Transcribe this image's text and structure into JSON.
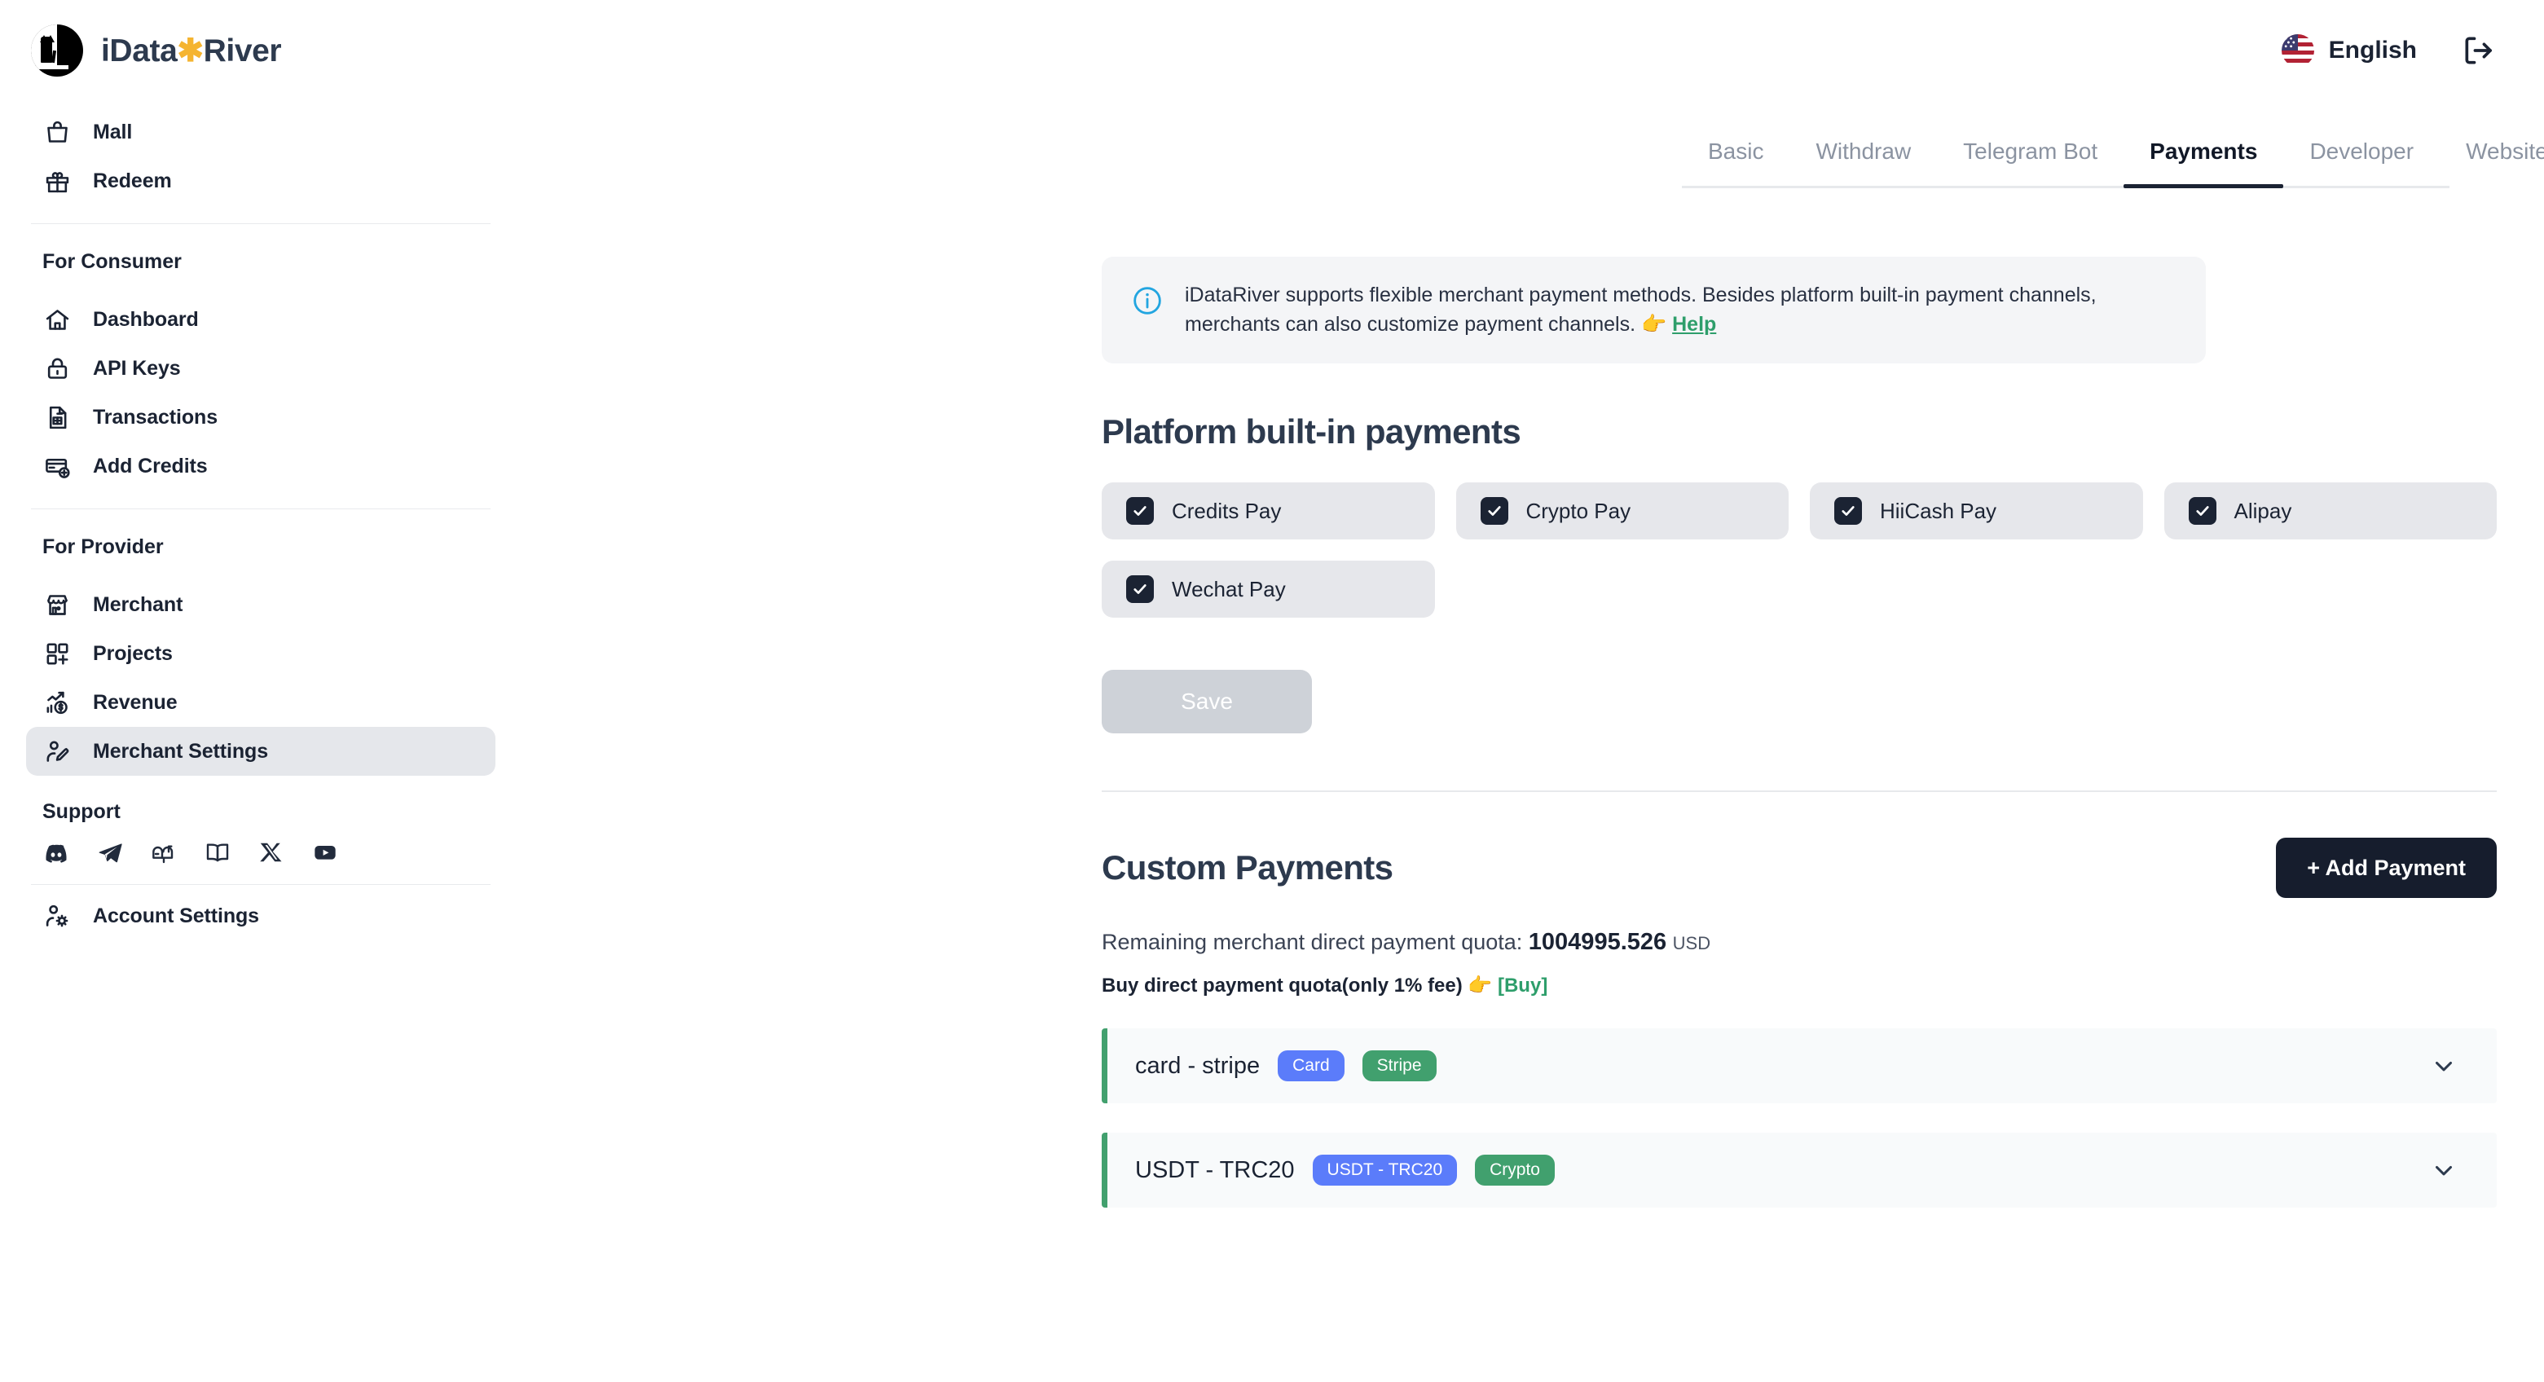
{
  "brand": {
    "name_part1": "iData",
    "star": "✱",
    "name_part2": "River"
  },
  "header": {
    "language_label": "English",
    "flag_icon": "us-flag-icon",
    "logout_icon": "logout-icon"
  },
  "sidebar": {
    "top_items": [
      {
        "label": "Mall",
        "icon": "shopping-bag-icon"
      },
      {
        "label": "Redeem",
        "icon": "gift-icon"
      }
    ],
    "consumer_group_title": "For Consumer",
    "consumer_items": [
      {
        "label": "Dashboard",
        "icon": "home-icon"
      },
      {
        "label": "API Keys",
        "icon": "lock-icon"
      },
      {
        "label": "Transactions",
        "icon": "document-list-icon"
      },
      {
        "label": "Add Credits",
        "icon": "card-plus-icon"
      }
    ],
    "provider_group_title": "For Provider",
    "provider_items": [
      {
        "label": "Merchant",
        "icon": "store-icon",
        "active": false
      },
      {
        "label": "Projects",
        "icon": "grid-plus-icon",
        "active": false
      },
      {
        "label": "Revenue",
        "icon": "revenue-chart-icon",
        "active": false
      },
      {
        "label": "Merchant Settings",
        "icon": "user-edit-icon",
        "active": true
      }
    ],
    "support_title": "Support",
    "support_icons": [
      "discord-icon",
      "telegram-icon",
      "mailbox-icon",
      "book-icon",
      "x-twitter-icon",
      "youtube-icon"
    ],
    "account_item": {
      "label": "Account Settings",
      "icon": "user-gear-icon"
    }
  },
  "tabs": [
    {
      "label": "Basic",
      "active": false
    },
    {
      "label": "Withdraw",
      "active": false
    },
    {
      "label": "Telegram Bot",
      "active": false
    },
    {
      "label": "Payments",
      "active": true
    },
    {
      "label": "Developer",
      "active": false
    },
    {
      "label": "Website",
      "active": false
    }
  ],
  "info_banner": {
    "icon": "info-circle-icon",
    "text": "iDataRiver supports flexible merchant payment methods. Besides platform built-in payment channels, merchants can also customize payment channels.",
    "pointer_emoji": "👉",
    "link_label": "Help"
  },
  "builtin": {
    "title": "Platform built-in payments",
    "methods": [
      {
        "label": "Credits Pay",
        "checked": true
      },
      {
        "label": "Crypto Pay",
        "checked": true
      },
      {
        "label": "HiiCash Pay",
        "checked": true
      },
      {
        "label": "Alipay",
        "checked": true
      },
      {
        "label": "Wechat Pay",
        "checked": true
      }
    ],
    "save_label": "Save",
    "save_disabled": true
  },
  "custom": {
    "title": "Custom Payments",
    "add_button_label": "+ Add Payment",
    "quota_prefix": "Remaining merchant direct payment quota:",
    "quota_value": "1004995.526",
    "quota_currency": "USD",
    "buy_text": "Buy direct payment quota(only 1% fee)",
    "buy_pointer": "👉",
    "buy_link": "[Buy]",
    "rows": [
      {
        "name": "card - stripe",
        "badge_primary": "Card",
        "badge_secondary": "Stripe",
        "chevron": "chevron-down-icon"
      },
      {
        "name": "USDT - TRC20",
        "badge_primary": "USDT - TRC20",
        "badge_secondary": "Crypto",
        "chevron": "chevron-down-icon"
      }
    ]
  },
  "colors": {
    "accent_dark": "#161d2d",
    "green": "#41a06e",
    "blue_badge": "#5b7cfa",
    "link_green": "#2e9e6b",
    "star_yellow": "#f5b430",
    "info_blue": "#22a5e0"
  }
}
